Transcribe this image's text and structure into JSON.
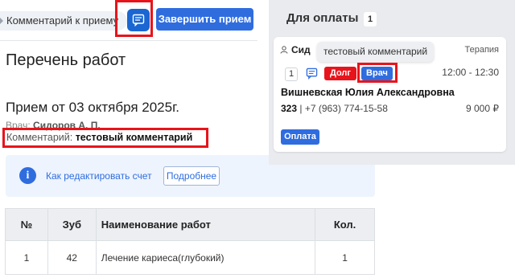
{
  "left": {
    "comment_chip_label": "Комментарий к приему",
    "finish_button_label": "Завершить прием",
    "page_title": "Перечень работ",
    "visit_title": "Прием от 03 октября 2025г.",
    "doctor_label": "Врач:",
    "doctor_name": "Сидоров А. П.",
    "comment_label": "Комментарий:",
    "comment_value": "тестовый комментарий",
    "info_text": "Как редактировать счет",
    "info_more_label": "Подробнее",
    "table": {
      "headers": [
        "№",
        "Зуб",
        "Наименование работ",
        "Кол."
      ],
      "rows": [
        {
          "no": "1",
          "tooth": "42",
          "name": "Лечение кариеса(глубокий)",
          "qty": "1"
        }
      ]
    }
  },
  "right": {
    "header_title": "Для оплаты",
    "count": "1",
    "card": {
      "doctor_partial": "Сид",
      "specialty": "Терапия",
      "tooltip": "тестовый комментарий",
      "number": "1",
      "tag_debt": "Долг",
      "tag_doctor": "Врач",
      "time": "12:00 - 12:30",
      "patient_name": "Вишневская Юлия Александровна",
      "patient_id": "323",
      "patient_phone": "| +7 (963) 774-15-58",
      "sum": "9 000 ₽",
      "pay_button": "Оплата"
    }
  },
  "colors": {
    "primary": "#2f6ddf",
    "highlight": "#e8141b",
    "debt": "#e8141b",
    "panel_bg": "#e9ebef"
  }
}
